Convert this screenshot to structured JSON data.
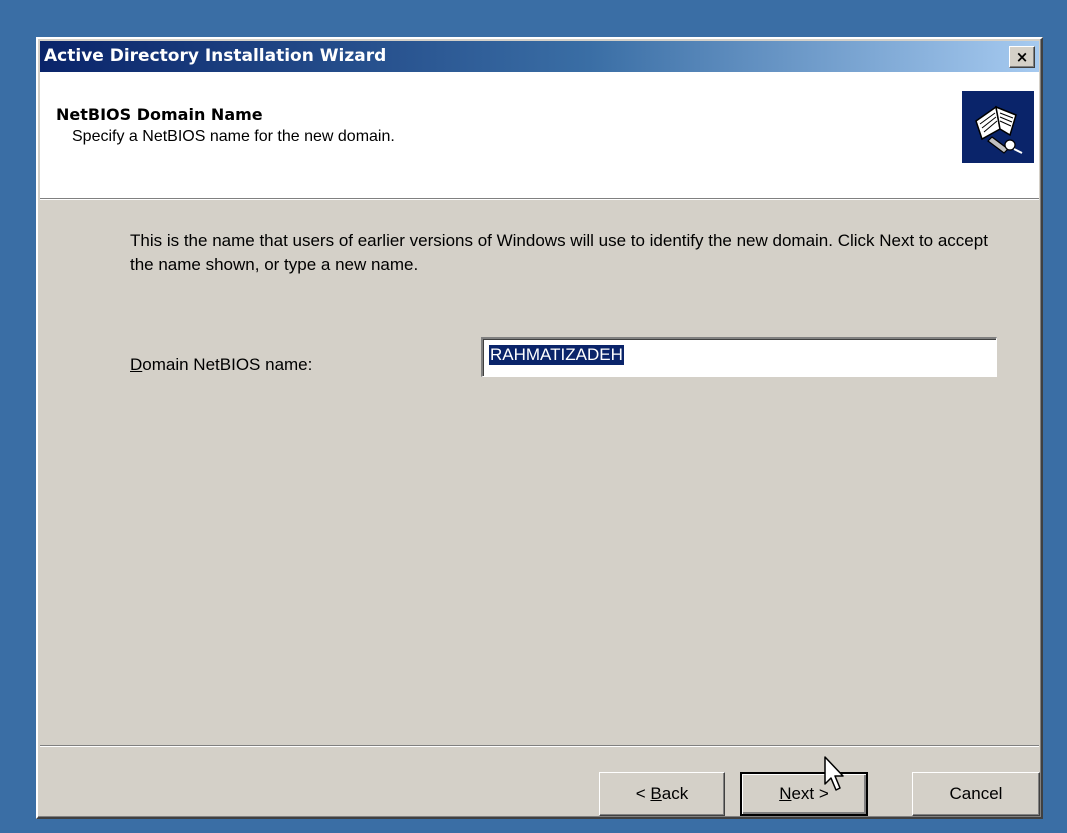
{
  "window": {
    "title": "Active Directory Installation Wizard",
    "close_symbol": "×"
  },
  "header": {
    "title": "NetBIOS Domain Name",
    "subtitle": "Specify a NetBIOS name for the new domain.",
    "icon": "book-icon"
  },
  "body": {
    "intro": "This is the name that users of earlier versions of Windows will use to identify the new domain. Click Next to accept the name shown, or type a new name.",
    "field_label_mnemonic": "D",
    "field_label_rest": "omain NetBIOS name:",
    "field_value": "RAHMATIZADEH"
  },
  "buttons": {
    "back_prefix": "< ",
    "back_mnemonic": "B",
    "back_rest": "ack",
    "next_mnemonic": "N",
    "next_rest": "ext >",
    "cancel": "Cancel"
  },
  "colors": {
    "desktop": "#3a6ea5",
    "title_start": "#0a246a",
    "selection": "#0a246a",
    "face": "#d4d0c8"
  }
}
